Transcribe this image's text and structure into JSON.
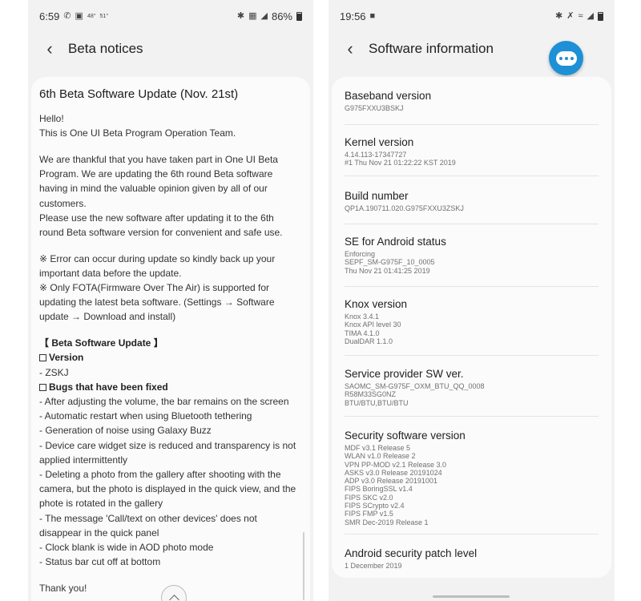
{
  "left": {
    "status": {
      "time": "6:59",
      "temp": "48°",
      "temp_small": "51°",
      "battery": "86%"
    },
    "app_title": "Beta notices",
    "article": {
      "title": "6th Beta Software Update (Nov. 21st)",
      "intro": [
        "Hello!",
        "This is One UI Beta Program Operation Team."
      ],
      "body": [
        "We are thankful that you have taken part in One UI Beta",
        "Program. We are updating the 6th round Beta software",
        "having in mind the valuable opinion given by all of our",
        "customers.",
        "Please use the new software after updating it to the 6th",
        "round Beta software version for convenient and safe use."
      ],
      "notes": [
        "※ Error can occur during update so kindly back up your",
        "important data before the update.",
        "※ Only FOTA(Firmware Over The Air) is supported for",
        "updating the latest beta software. (Settings → Software",
        "update → Download and install)"
      ],
      "section_heading": "【 Beta Software Update 】",
      "version_label": "Version",
      "version_value": "- ZSKJ",
      "bugs_label": "Bugs that have been fixed",
      "fixes": [
        " - After adjusting the volume, the bar remains on the screen",
        " - Automatic restart when using Bluetooth tethering",
        " - Generation of noise using Galaxy Buzz",
        " - Device care widget size is reduced and transparency is not",
        "applied intermittently",
        " - Deleting a photo from the gallery after shooting with the",
        "camera, but the photo is displayed in the quick view, and the",
        "phote is rotated in the gallery",
        " - The message 'Call/text on other devices' does not",
        "disappear in the quick panel",
        " - Clock blank is wide in AOD photo mode",
        " - Status bar cut off at bottom"
      ],
      "closing": "Thank you!"
    }
  },
  "right": {
    "status": {
      "time": "19:56"
    },
    "app_title": "Software information",
    "items": [
      {
        "title": "Baseband version",
        "value": "G975FXXU3BSKJ"
      },
      {
        "title": "Kernel version",
        "value": "4.14.113-17347727\n#1 Thu Nov 21 01:22:22 KST 2019"
      },
      {
        "title": "Build number",
        "value": "QP1A.190711.020.G975FXXU3ZSKJ"
      },
      {
        "title": "SE for Android status",
        "value": "Enforcing\nSEPF_SM-G975F_10_0005\nThu Nov 21 01:41:25 2019"
      },
      {
        "title": "Knox version",
        "value": "Knox 3.4.1\nKnox API level 30\nTIMA 4.1.0\nDualDAR 1.1.0"
      },
      {
        "title": "Service provider SW ver.",
        "value": "SAOMC_SM-G975F_OXM_BTU_QQ_0008\nR58M33SG0NZ\nBTU/BTU,BTU/BTU"
      },
      {
        "title": "Security software version",
        "value": "MDF v3.1 Release 5\nWLAN v1.0 Release 2\nVPN PP-MOD v2.1 Release 3.0\nASKS v3.0 Release 20191024\nADP v3.0 Release 20191001\nFIPS BoringSSL v1.4\nFIPS SKC v2.0\nFIPS SCrypto v2.4\nFIPS FMP v1.5\nSMR Dec-2019 Release 1"
      },
      {
        "title": "Android security patch level",
        "value": "1 December 2019"
      }
    ]
  },
  "colors": {
    "panel_bg": "#f2f2f2",
    "card_bg": "#fbfbfb",
    "fab_blue": "#1e90d6"
  },
  "icons": [
    "whatsapp-icon",
    "gallery-icon",
    "weather-icon",
    "bluetooth-icon",
    "nfc-icon",
    "signal-icon",
    "battery-icon",
    "message-icon",
    "mute-icon",
    "wifi-icon",
    "back-arrow-icon",
    "chat-bubble-icon",
    "chevron-up-icon"
  ]
}
